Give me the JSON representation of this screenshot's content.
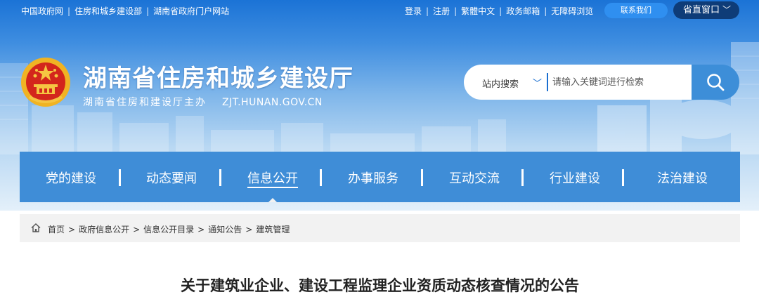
{
  "topbar": {
    "left_links": [
      "中国政府网",
      "住房和城乡建设部",
      "湖南省政府门户网站"
    ],
    "right_links": [
      "登录",
      "注册",
      "繁體中文",
      "政务邮箱",
      "无障碍浏览"
    ],
    "contact_label": "联系我们",
    "window_label": "省直窗口"
  },
  "site": {
    "title": "湖南省住房和城乡建设厅",
    "subtitle": "湖南省住房和建设厅主办",
    "url": "ZJT.HUNAN.GOV.CN"
  },
  "search": {
    "scope": "站内搜索",
    "placeholder": "请输入关键词进行检索"
  },
  "nav": {
    "items": [
      "党的建设",
      "动态要闻",
      "信息公开",
      "办事服务",
      "互动交流",
      "行业建设",
      "法治建设"
    ],
    "active_index": 2
  },
  "breadcrumb": [
    "首页",
    "政府信息公开",
    "信息公开目录",
    "通知公告",
    "建筑管理"
  ],
  "article": {
    "title": "关于建筑业企业、建设工程监理企业资质动态核查情况的公告"
  },
  "colors": {
    "nav_bg": "#3f8dd7",
    "window_btn": "#0e3c78",
    "contact_btn": "#2f8ff0",
    "search_btn": "#3d8ed8"
  },
  "icons": {
    "search": "search-icon",
    "home": "home-icon",
    "emblem": "national-emblem-icon",
    "chevron": "chevron-down-icon"
  }
}
